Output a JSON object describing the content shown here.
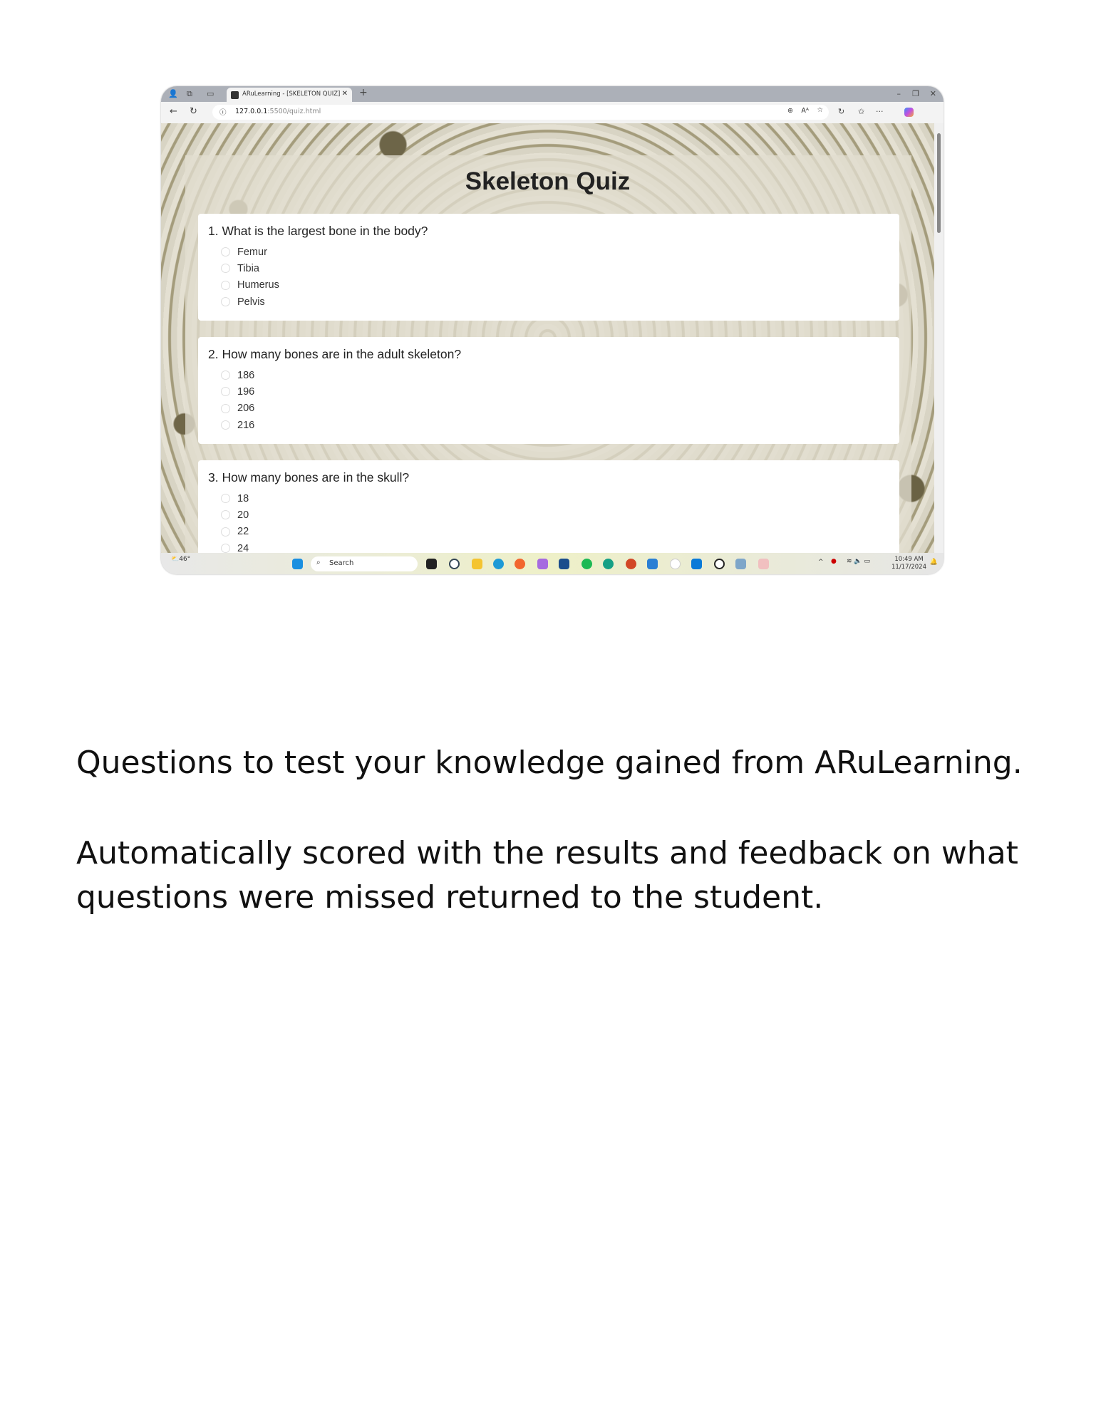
{
  "browser": {
    "tab_title": "ARuLearning - [SKELETON QUIZ]",
    "url_host": "127.0.0.1",
    "url_rest": ":5500/quiz.html"
  },
  "quiz": {
    "title": "Skeleton Quiz",
    "questions": [
      {
        "text": "1. What is the largest bone in the body?",
        "options": [
          "Femur",
          "Tibia",
          "Humerus",
          "Pelvis"
        ]
      },
      {
        "text": "2. How many bones are in the adult skeleton?",
        "options": [
          "186",
          "196",
          "206",
          "216"
        ]
      },
      {
        "text": "3. How many bones are in the skull?",
        "options": [
          "18",
          "20",
          "22",
          "24"
        ]
      }
    ]
  },
  "taskbar": {
    "weather": "46°",
    "search": "Search",
    "time": "10:49 AM",
    "date": "11/17/2024"
  },
  "captions": [
    "Questions to test your knowledge gained from ARuLearning.",
    "Automatically scored with the results and feedback on what questions were missed returned to the student."
  ]
}
